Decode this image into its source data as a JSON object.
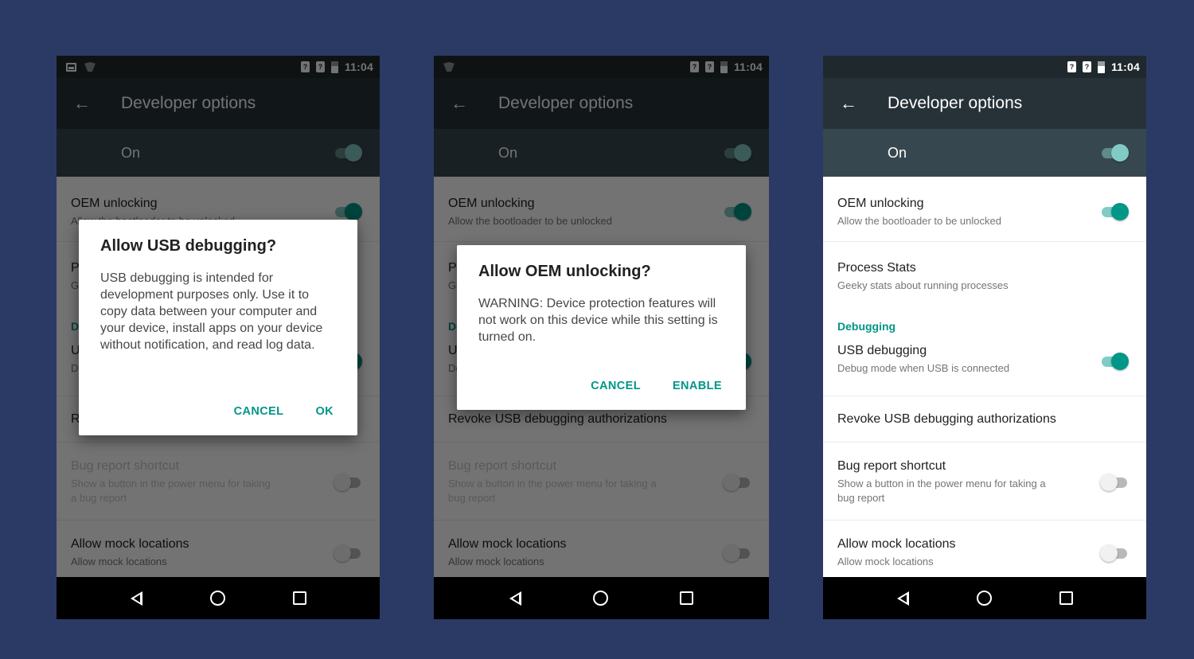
{
  "colors": {
    "background": "#2b3a64",
    "statusbar": "#1f282c",
    "appbar": "#263238",
    "master_bar": "#37474f",
    "accent": "#009688"
  },
  "screens": [
    {
      "status_bar": {
        "time": "11:04",
        "left_icons": [
          "image-notification-icon",
          "wifi-icon"
        ],
        "right_icons": [
          "sim-card-1-icon",
          "sim-card-2-icon",
          "battery-icon"
        ]
      },
      "app_bar": {
        "back_icon": "arrow-back-icon",
        "title": "Developer options"
      },
      "master_switch": {
        "label": "On",
        "checked": true
      },
      "list": {
        "oem": {
          "title": "OEM unlocking",
          "subtitle": "Allow the bootloader to be unlocked",
          "checked": true
        },
        "process": {
          "title": "Process Stats",
          "subtitle": "Geeky stats about running processes"
        },
        "category": "Debugging",
        "usb": {
          "title": "USB debugging",
          "subtitle": "Debug mode when USB is connected",
          "checked": true
        },
        "revoke": {
          "title": "Revoke USB debugging authorizations"
        },
        "bug": {
          "title": "Bug report shortcut",
          "subtitle": "Show a button in the power menu for taking a bug report",
          "checked": false
        },
        "mock": {
          "title": "Allow mock locations",
          "subtitle": "Allow mock locations",
          "checked": false
        }
      },
      "dialog": {
        "title": "Allow USB debugging?",
        "body": "USB debugging is intended for development purposes only. Use it to copy data between your computer and your device, install apps on your device without notification, and read log data.",
        "cancel": "CANCEL",
        "confirm": "OK"
      }
    },
    {
      "status_bar": {
        "time": "11:04",
        "left_icons": [
          "wifi-icon"
        ],
        "right_icons": [
          "sim-card-1-icon",
          "sim-card-2-icon",
          "battery-icon"
        ]
      },
      "app_bar": {
        "back_icon": "arrow-back-icon",
        "title": "Developer options"
      },
      "master_switch": {
        "label": "On",
        "checked": true
      },
      "list": {
        "oem": {
          "title": "OEM unlocking",
          "subtitle": "Allow the bootloader to be unlocked",
          "checked": true
        },
        "process": {
          "title": "Process Stats",
          "subtitle": "Geeky stats about running processes"
        },
        "category": "Debugging",
        "usb": {
          "title": "USB debugging",
          "subtitle": "Debug mode when USB is connected",
          "checked": true
        },
        "revoke": {
          "title": "Revoke USB debugging authorizations"
        },
        "bug": {
          "title": "Bug report shortcut",
          "subtitle": "Show a button in the power menu for taking a bug report",
          "checked": false
        },
        "mock": {
          "title": "Allow mock locations",
          "subtitle": "Allow mock locations",
          "checked": false
        }
      },
      "dialog": {
        "title": "Allow OEM unlocking?",
        "body": "WARNING: Device protection features will not work on this device while this setting is turned on.",
        "cancel": "CANCEL",
        "confirm": "ENABLE"
      }
    },
    {
      "status_bar": {
        "time": "11:04",
        "left_icons": [],
        "right_icons": [
          "sim-card-1-icon",
          "sim-card-2-icon",
          "battery-icon"
        ]
      },
      "app_bar": {
        "back_icon": "arrow-back-icon",
        "title": "Developer options"
      },
      "master_switch": {
        "label": "On",
        "checked": true
      },
      "list": {
        "oem": {
          "title": "OEM unlocking",
          "subtitle": "Allow the bootloader to be unlocked",
          "checked": true
        },
        "process": {
          "title": "Process Stats",
          "subtitle": "Geeky stats about running processes"
        },
        "category": "Debugging",
        "usb": {
          "title": "USB debugging",
          "subtitle": "Debug mode when USB is connected",
          "checked": true
        },
        "revoke": {
          "title": "Revoke USB debugging authorizations"
        },
        "bug": {
          "title": "Bug report shortcut",
          "subtitle": "Show a button in the power menu for taking a bug report",
          "checked": false
        },
        "mock": {
          "title": "Allow mock locations",
          "subtitle": "Allow mock locations",
          "checked": false
        }
      }
    }
  ],
  "nav_bar": {
    "icons": [
      "nav-back-icon",
      "nav-home-icon",
      "nav-recents-icon"
    ]
  }
}
